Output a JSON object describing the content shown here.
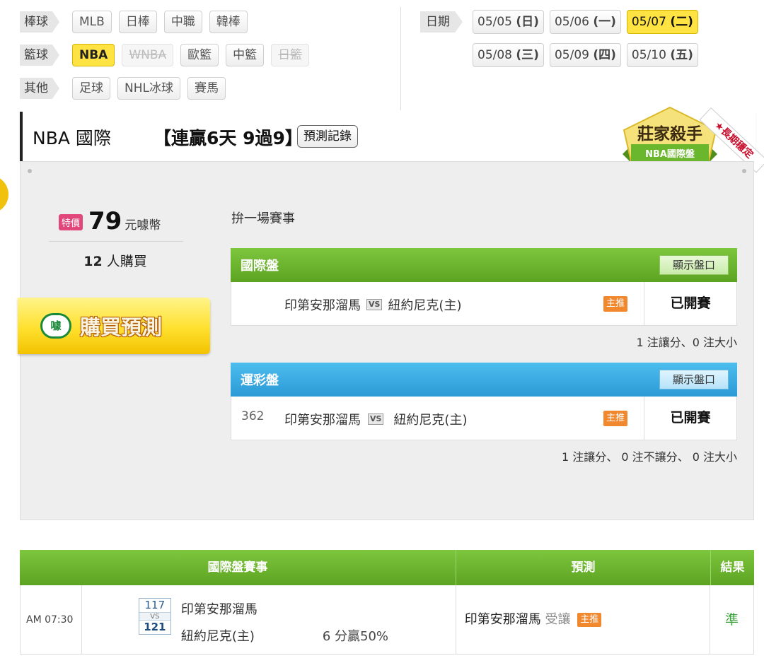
{
  "filters": {
    "baseball": {
      "label": "棒球",
      "items": [
        {
          "label": "MLB",
          "state": "normal"
        },
        {
          "label": "日棒",
          "state": "normal"
        },
        {
          "label": "中職",
          "state": "normal"
        },
        {
          "label": "韓棒",
          "state": "normal"
        }
      ]
    },
    "basketball": {
      "label": "籃球",
      "items": [
        {
          "label": "NBA",
          "state": "active"
        },
        {
          "label": "WNBA",
          "state": "disabled"
        },
        {
          "label": "歐籃",
          "state": "normal"
        },
        {
          "label": "中籃",
          "state": "normal"
        },
        {
          "label": "日籃",
          "state": "disabled"
        }
      ]
    },
    "other": {
      "label": "其他",
      "items": [
        {
          "label": "足球",
          "state": "normal"
        },
        {
          "label": "NHL冰球",
          "state": "normal"
        },
        {
          "label": "賽馬",
          "state": "normal"
        }
      ]
    }
  },
  "dates": {
    "label": "日期",
    "row1": [
      {
        "date": "05/05",
        "weekday": "(日)",
        "active": false
      },
      {
        "date": "05/06",
        "weekday": "(一)",
        "active": false
      },
      {
        "date": "05/07",
        "weekday": "(二)",
        "active": true
      }
    ],
    "row2": [
      {
        "date": "05/08",
        "weekday": "(三)",
        "active": false
      },
      {
        "date": "05/09",
        "weekday": "(四)",
        "active": false
      },
      {
        "date": "05/10",
        "weekday": "(五)",
        "active": false
      }
    ]
  },
  "header": {
    "title": "NBA 國際",
    "streak": "【連贏6天 9過9】",
    "record_button": "預測記錄",
    "badge_title": "莊家殺手",
    "badge_sub": "NBA國際盤",
    "ribbon": "★長期穩定"
  },
  "purchase": {
    "special_tag": "特價",
    "price": "79",
    "currency": "元噱幣",
    "buyers_count": "12",
    "buyers_suffix": "人購買",
    "buy_icon": "噱",
    "buy_button": "購買預測"
  },
  "picks": {
    "label": "拚一場賽事",
    "international": {
      "title": "國際盤",
      "toggle": "顯示盤口",
      "number": "",
      "away": "印第安那溜馬",
      "vs": "VS",
      "home": "紐約尼克(主)",
      "tag": "主推",
      "status": "已開賽",
      "note": "1 注讓分、0 注大小"
    },
    "sports_lottery": {
      "title": "運彩盤",
      "toggle": "顯示盤口",
      "number": "362",
      "away": "印第安那溜馬",
      "vs": "VS",
      "home": "紐約尼克(主)",
      "tag": "主推",
      "status": "已開賽",
      "note": "1 注讓分、 0 注不讓分、 0 注大小"
    }
  },
  "history": {
    "headers": {
      "games": "國際盤賽事",
      "prediction": "預測",
      "result": "結果"
    },
    "rows": [
      {
        "time": "AM 07:30",
        "away_score": "117",
        "vs": "VS",
        "home_score": "121",
        "away": "印第安那溜馬",
        "home": "紐約尼克(主)",
        "margin": "6 分贏50%",
        "pick_team": "印第安那溜馬",
        "pick_type": "受讓",
        "pick_tag": "主推",
        "result": "準"
      }
    ]
  },
  "colors": {
    "accent_yellow": "#ffe342",
    "green": "#6db52d",
    "blue": "#3aaee6",
    "tag_orange": "#f2882e",
    "special_pink": "#e1477a"
  }
}
